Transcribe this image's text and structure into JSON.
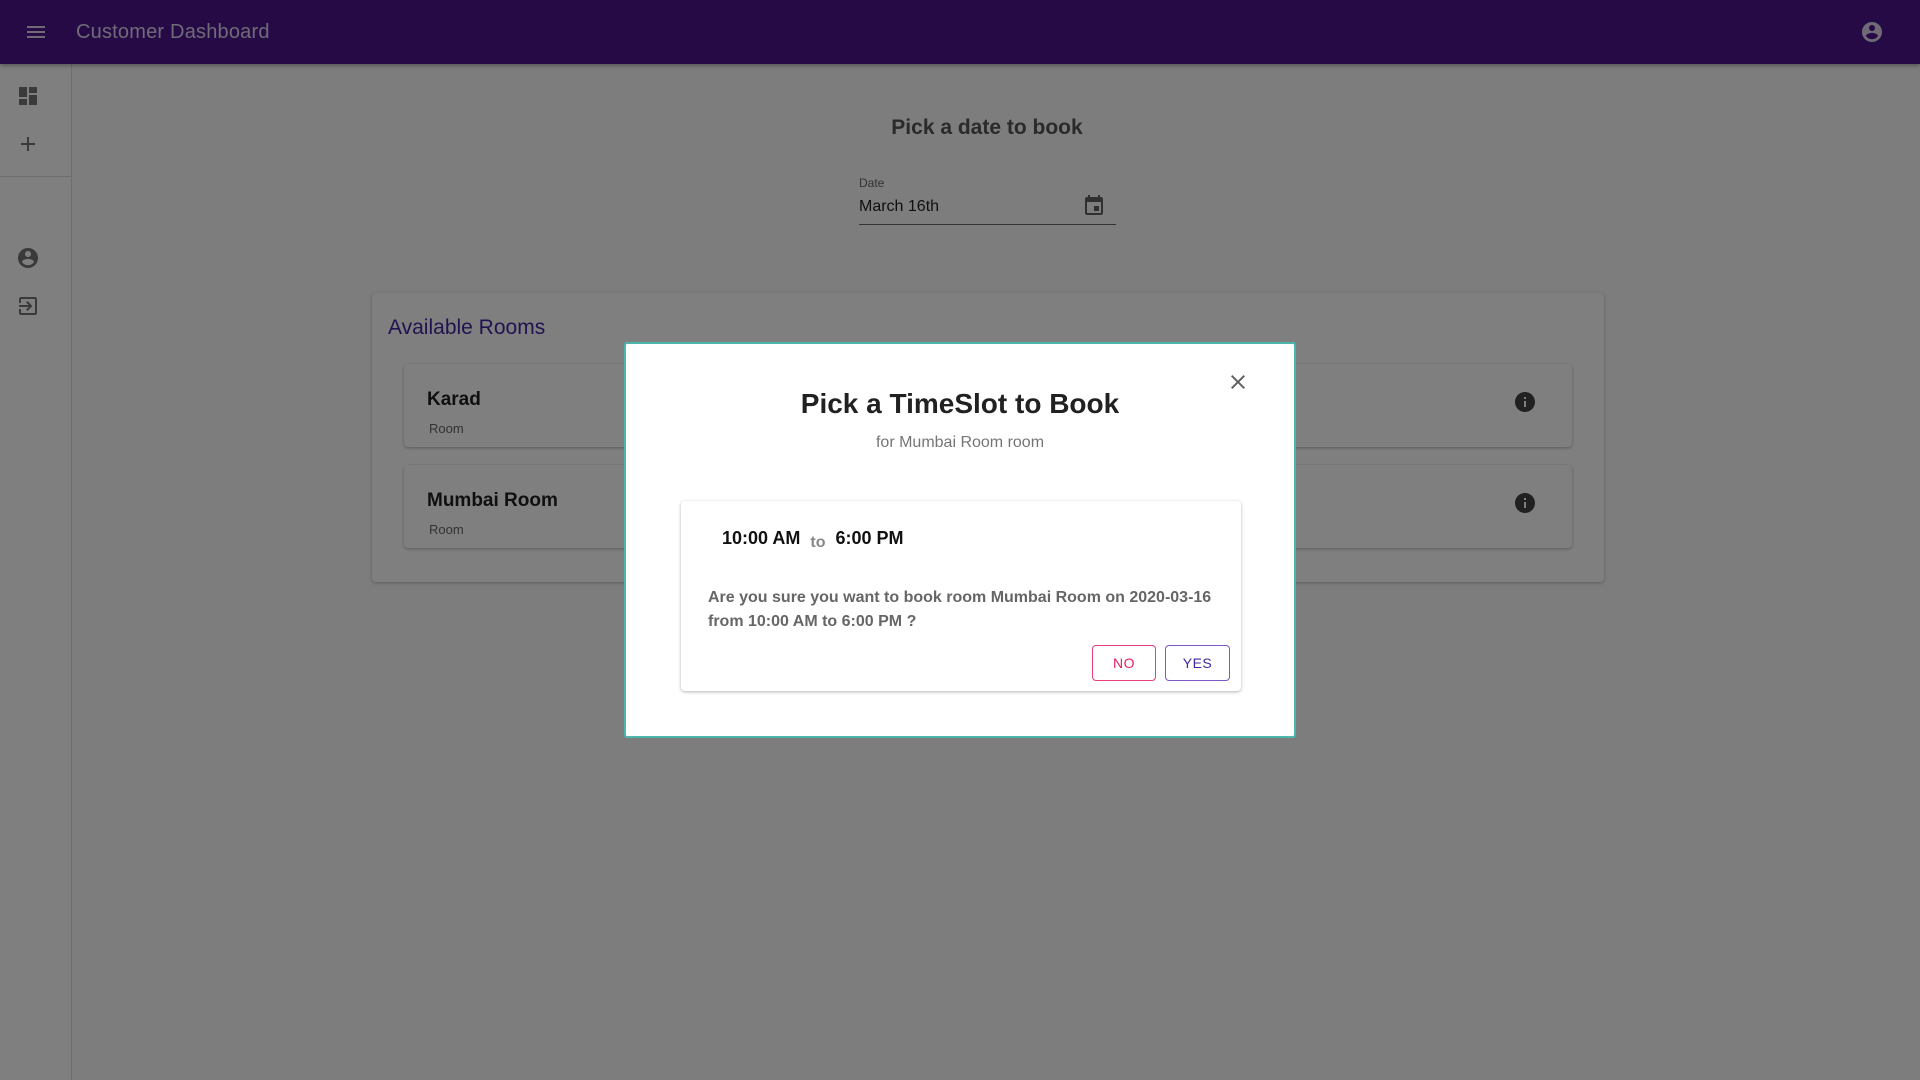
{
  "app": {
    "title": "Customer Dashboard",
    "colors": {
      "appbar": "#4a148c",
      "accent": "#4527a0",
      "secondary": "#e91e63",
      "dialog_border": "#4db6ac"
    }
  },
  "appbar": {
    "menu_icon": "menu-icon",
    "account_icon": "account-circle-icon"
  },
  "drawer": {
    "items": [
      {
        "icon": "dashboard-icon"
      },
      {
        "icon": "add-icon"
      },
      {
        "icon": "account-circle-icon"
      },
      {
        "icon": "logout-icon"
      }
    ]
  },
  "page": {
    "heading": "Pick a date to book",
    "date_field": {
      "label": "Date",
      "value": "March 16th",
      "icon": "calendar-icon"
    }
  },
  "rooms": {
    "title": "Available Rooms",
    "items": [
      {
        "name": "Karad",
        "type": "Room",
        "icon": "info-icon"
      },
      {
        "name": "Mumbai Room",
        "type": "Room",
        "icon": "info-icon"
      }
    ]
  },
  "dialog": {
    "title": "Pick a TimeSlot to Book",
    "subtitle": "for Mumbai Room room",
    "close_icon": "close-icon",
    "slot": {
      "start": "10:00 AM",
      "separator": "to",
      "end": "6:00 PM",
      "confirm_text": "Are you sure you want to book room Mumbai Room on 2020-03-16 from 10:00 AM to 6:00 PM ?",
      "no_label": "No",
      "yes_label": "Yes"
    }
  }
}
